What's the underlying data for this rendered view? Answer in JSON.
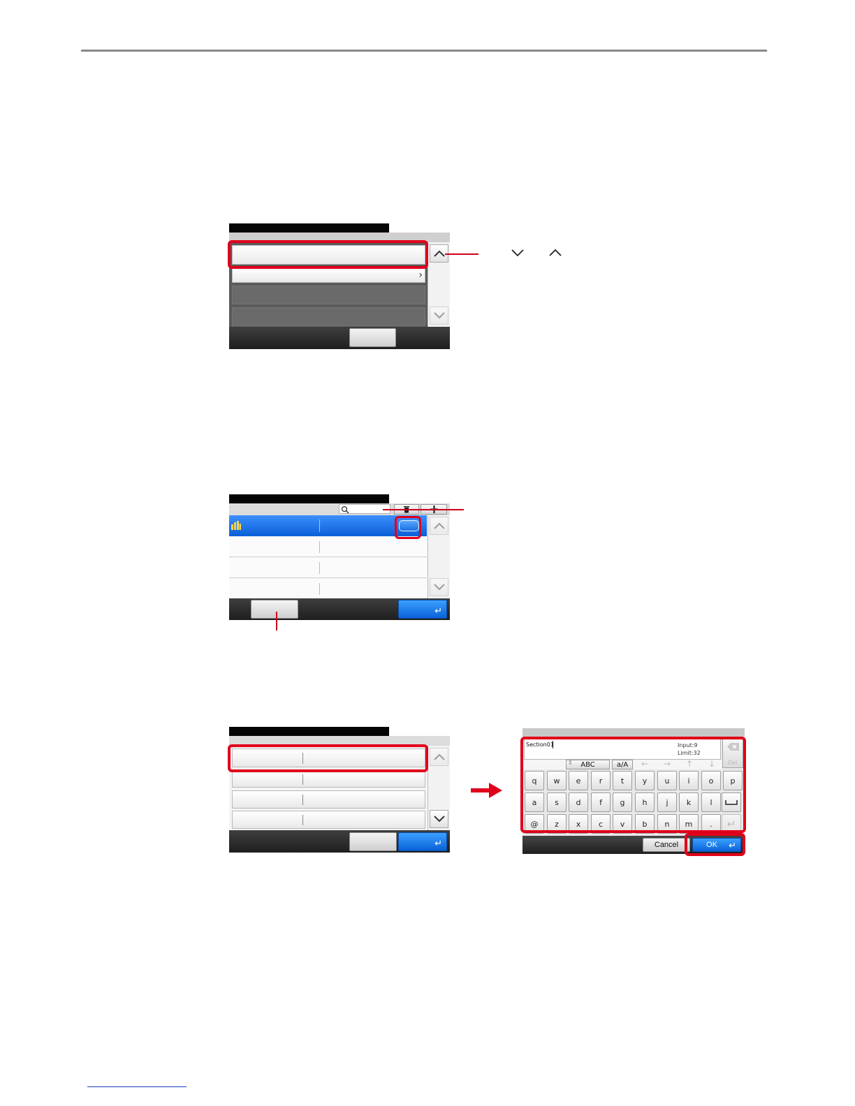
{
  "callouts": {
    "scroll_hint_down": "∨",
    "scroll_hint_up": "∧"
  },
  "keyboard": {
    "input_value": "Section01",
    "input_count": "Input:9",
    "input_limit": "Limit:32",
    "mode_button": "ABC",
    "case_button": "a/A",
    "delete_label": "Del",
    "rows": [
      [
        "q",
        "w",
        "e",
        "r",
        "t",
        "y",
        "u",
        "i",
        "o",
        "p"
      ],
      [
        "a",
        "s",
        "d",
        "f",
        "g",
        "h",
        "j",
        "k",
        "l"
      ],
      [
        "@",
        "z",
        "x",
        "c",
        "v",
        "b",
        "n",
        "m",
        "."
      ]
    ],
    "cancel_label": "Cancel",
    "ok_label": "OK"
  },
  "colors": {
    "accent_red": "#e0001b",
    "button_blue": "#0a62d8",
    "title_black": "#050505"
  }
}
